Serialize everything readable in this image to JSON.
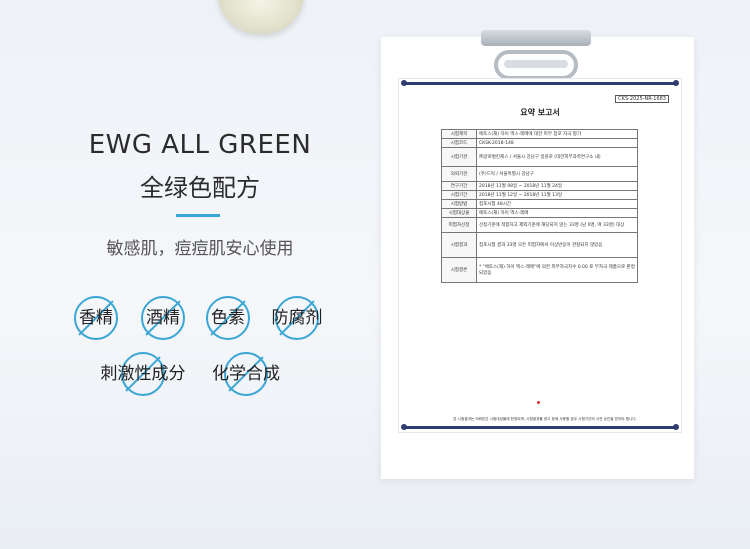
{
  "headline": {
    "en": "EWG ALL GREEN",
    "cn": "全绿色配方"
  },
  "subtitle": "敏感肌，痘痘肌安心使用",
  "badges": [
    {
      "label": "香精",
      "icon": "no-fragrance-icon"
    },
    {
      "label": "酒精",
      "icon": "no-alcohol-icon"
    },
    {
      "label": "色素",
      "icon": "no-pigment-icon"
    },
    {
      "label": "防腐剂",
      "icon": "no-preservative-icon"
    },
    {
      "label": "刺激性成分",
      "icon": "no-irritant-icon"
    },
    {
      "label": "化学合成",
      "icon": "no-chemical-icon"
    }
  ],
  "accent_color": "#3aa6d6",
  "document": {
    "doc_no": "CKS-2025-NR-1683",
    "title": "요약 보고서",
    "rows": [
      {
        "key": "시험제목",
        "value": "에토스(재) 하이 엑스-레메에 대한 피부 첩포 자극 평가"
      },
      {
        "key": "시험코드",
        "value": "CKSK-2018-148"
      },
      {
        "key": "시험기관",
        "value": "㈜글로벌킨제스 / 서울시 강남구 일원로 (대한피부과학연구소 내)"
      },
      {
        "key": "의뢰기관",
        "value": "(주)드럭 / 서울특별시 강남구"
      },
      {
        "key": "연구기간",
        "value": "2018년 11월 08일 ~ 2018년 11월 24일"
      },
      {
        "key": "시험기간",
        "value": "2018년 11월 12일 ~ 2018년 11월 13일"
      },
      {
        "key": "시험방법",
        "value": "첩포시험 48시간"
      },
      {
        "key": "시험대상물",
        "value": "에토스(재) 하이 엑스-레메"
      },
      {
        "key": "피험자선정",
        "value": "선정기준에 적합하고 제외기준에 해당되지 않는 33명 (남 0명, 여 33명) 대상"
      },
      {
        "key": "시험결과",
        "value": "첩포시험 결과 33명 모든 피험자에서 이상반응이 관찰되지 않았음"
      },
      {
        "key": "시험결론",
        "value": "* \"에토스(재) 하이 엑스-레메\"에 의한 피부자극지수 0.00 로 무자극 제품으로 판정되었음"
      }
    ],
    "footer": "본 시험결과는 의뢰받은 시험대상물에 한정되며, 시험결과를 광고 등에 사용할 경우 시험기관의 사전 승인을 받아야 합니다."
  }
}
